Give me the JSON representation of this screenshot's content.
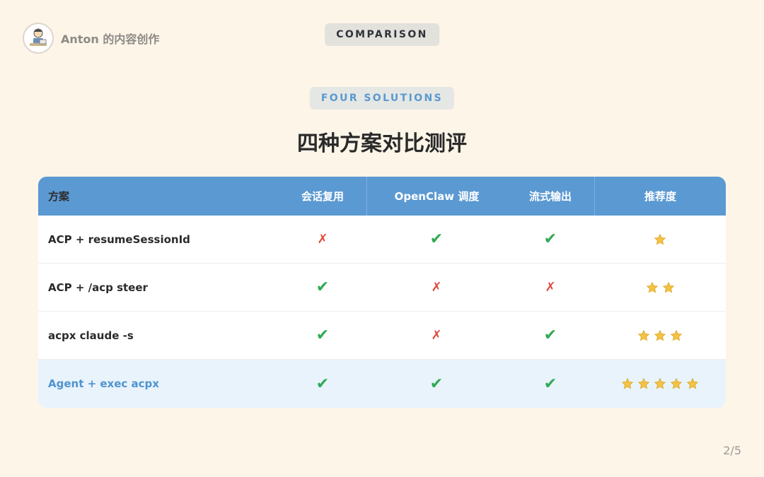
{
  "author": {
    "name": "Anton 的内容创作"
  },
  "tags": {
    "top": "COMPARISON",
    "sub": "FOUR SOLUTIONS"
  },
  "title": "四种方案对比测评",
  "table": {
    "headers": [
      "方案",
      "会话复用",
      "OpenClaw 调度",
      "流式输出",
      "推荐度"
    ],
    "rows": [
      {
        "name": "ACP + resumeSessionId",
        "session_reuse": "✗",
        "openclaw": "✔",
        "streaming": "✔",
        "rating": 1,
        "highlight": false
      },
      {
        "name": "ACP + /acp steer",
        "session_reuse": "✔",
        "openclaw": "✗",
        "streaming": "✗",
        "rating": 2,
        "highlight": false
      },
      {
        "name": "acpx claude -s",
        "session_reuse": "✔",
        "openclaw": "✗",
        "streaming": "✔",
        "rating": 3,
        "highlight": false
      },
      {
        "name": "Agent + exec acpx",
        "session_reuse": "✔",
        "openclaw": "✔",
        "streaming": "✔",
        "rating": 5,
        "highlight": true
      }
    ]
  },
  "colors": {
    "header_bg": "#5b99d2",
    "check": "#2faa55",
    "cross": "#de4a3c",
    "highlight_text": "#4f93d0",
    "star": "#f6c244"
  },
  "page_number": "2/5"
}
